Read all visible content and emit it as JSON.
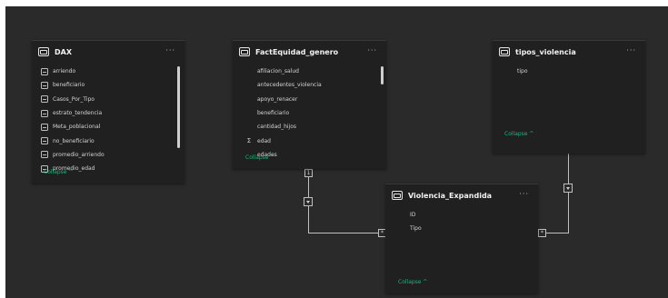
{
  "tables": {
    "dax": {
      "title": "DAX",
      "more": "···",
      "fields": [
        "arriendo",
        "beneficiario",
        "Casos_Por_Tipo",
        "estrato_tendencia",
        "Meta_poblacional",
        "no_beneficiario",
        "promedio_arriendo",
        "promedio_edad"
      ],
      "collapse": "Collapse ^"
    },
    "fact": {
      "title": "FactEquidad_genero",
      "more": "···",
      "fields": [
        "afiliacion_salud",
        "antecedentes_violencia",
        "apoyo_renacer",
        "beneficiario",
        "cantidad_hijos",
        "edad",
        "edades"
      ],
      "collapse": "Collapse ^"
    },
    "tipos": {
      "title": "tipos_violencia",
      "more": "···",
      "fields": [
        "tipo"
      ],
      "collapse": "Collapse ^"
    },
    "violencia": {
      "title": "Violencia_Expandida",
      "more": "···",
      "fields": [
        "ID",
        "Tipo"
      ],
      "collapse": "Collapse ^"
    }
  },
  "relationships": {
    "fact_one": "1",
    "fact_many": "*",
    "tipos_one": "1",
    "tipos_many": "*"
  },
  "icons": {
    "table": "table-icon",
    "field": "field-icon",
    "measure": "sigma-icon",
    "more": "more-options-icon",
    "cross_filter": "arrow-down-icon"
  },
  "colors": {
    "canvas": "#2a2a2a",
    "card": "#202020",
    "collapse": "#1fb37c"
  }
}
